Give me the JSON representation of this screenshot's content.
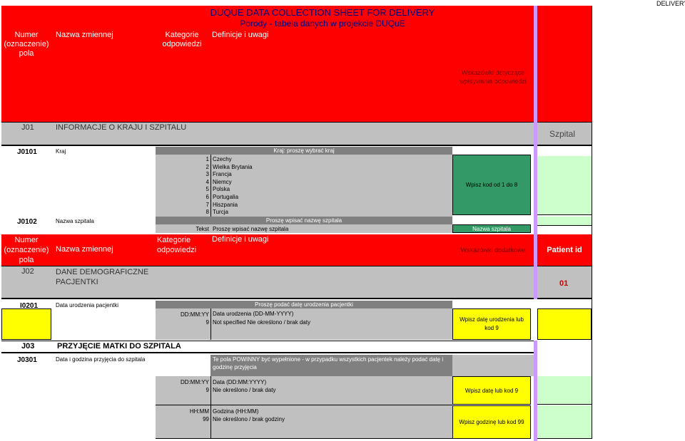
{
  "corner_label": "DELIVERY",
  "header": {
    "title": "DUQUE DATA COLLECTION SHEET FOR DELIVERY",
    "subtitle": "Porody - tabela danych w projekcie DUQuE",
    "col_numer": "Numer (oznaczenie) pola",
    "col_nazwa": "Nazwa zmiennej",
    "col_kategorie": "Kategorie odpowiedzi",
    "col_definicje": "Definicje i uwagi",
    "col_wskazowki": "Wskazówki dotyczące wpisywania odpowiedzi"
  },
  "j01": {
    "code": "J01",
    "title": "INFORMACJE O KRAJU I SZPITALU",
    "right_label": "Szpital"
  },
  "j0101": {
    "code": "J0101",
    "name": "Kraj",
    "definition": "Kraj: proszę wybrać kraj",
    "options": [
      {
        "num": "1",
        "label": "Czechy"
      },
      {
        "num": "2",
        "label": "Wielka Brytania"
      },
      {
        "num": "3",
        "label": "Francja"
      },
      {
        "num": "4",
        "label": "Niemcy"
      },
      {
        "num": "5",
        "label": "Polska"
      },
      {
        "num": "6",
        "label": "Portugalia"
      },
      {
        "num": "7",
        "label": "Hiszpania"
      },
      {
        "num": "8",
        "label": "Turcja"
      }
    ],
    "hint": "Wpisz kod od 1 do 8"
  },
  "j0102": {
    "code": "J0102",
    "name": "Nazwa szpitala",
    "definition": "Proszę wpisać nazwę szpitala",
    "cat": "Tekst",
    "cat_text": "Proszę wpisać nazwę szpitala",
    "hint": "Nazwa szpitala"
  },
  "header2": {
    "col_numer": "Numer (oznaczenie) pola",
    "col_nazwa": "Nazwa zmiennej",
    "col_kategorie": "Kategorie odpowiedzi",
    "col_definicje": "Definicje i uwagi",
    "col_wskazowki": "Wskazówki dodatkowe",
    "col_patient": "Patient id"
  },
  "j02": {
    "code": "J02",
    "title": "DANE DEMOGRAFICZNE PACJENTKI",
    "patient_value": "01"
  },
  "i0201": {
    "code": "I0201",
    "name": "Data urodzenia pacjentki",
    "definition": "Proszę podać datę urodzenia pacjentki",
    "opt1_cat": "DD:MM:YY",
    "opt1_label": "Data urodzenia (DD-MM-YYYY)",
    "opt2_cat": "9",
    "opt2_label": "Not specified Nie określono / brak daty",
    "hint": "Wpisz datę urodzenia lub kod 9"
  },
  "j03": {
    "code": "J03",
    "title": "PRZYJĘCIE MATKI DO SZPITALA"
  },
  "j0301": {
    "code": "J0301",
    "name": "Data i godzina przyjęcia do szpitala",
    "definition": "Te pola POWINNY być wypełnione - w przypadku wszystkich pacjentek należy podać datę i godzinę przyjęcia",
    "date_cat": "DD:MM:YY",
    "date_label": "Data (DD:MM:YYYY)",
    "date_nc_cat": "9",
    "date_nc_label": "Nie określono / brak daty",
    "date_hint": "Wpisz datę lub kod 9",
    "time_cat": "HH:MM",
    "time_label": "Godzina (HH:MM)",
    "time_nc_cat": "99",
    "time_nc_label": "Nie określono / brak godziny",
    "time_hint": "Wpisz godzinę lub kod 99"
  }
}
